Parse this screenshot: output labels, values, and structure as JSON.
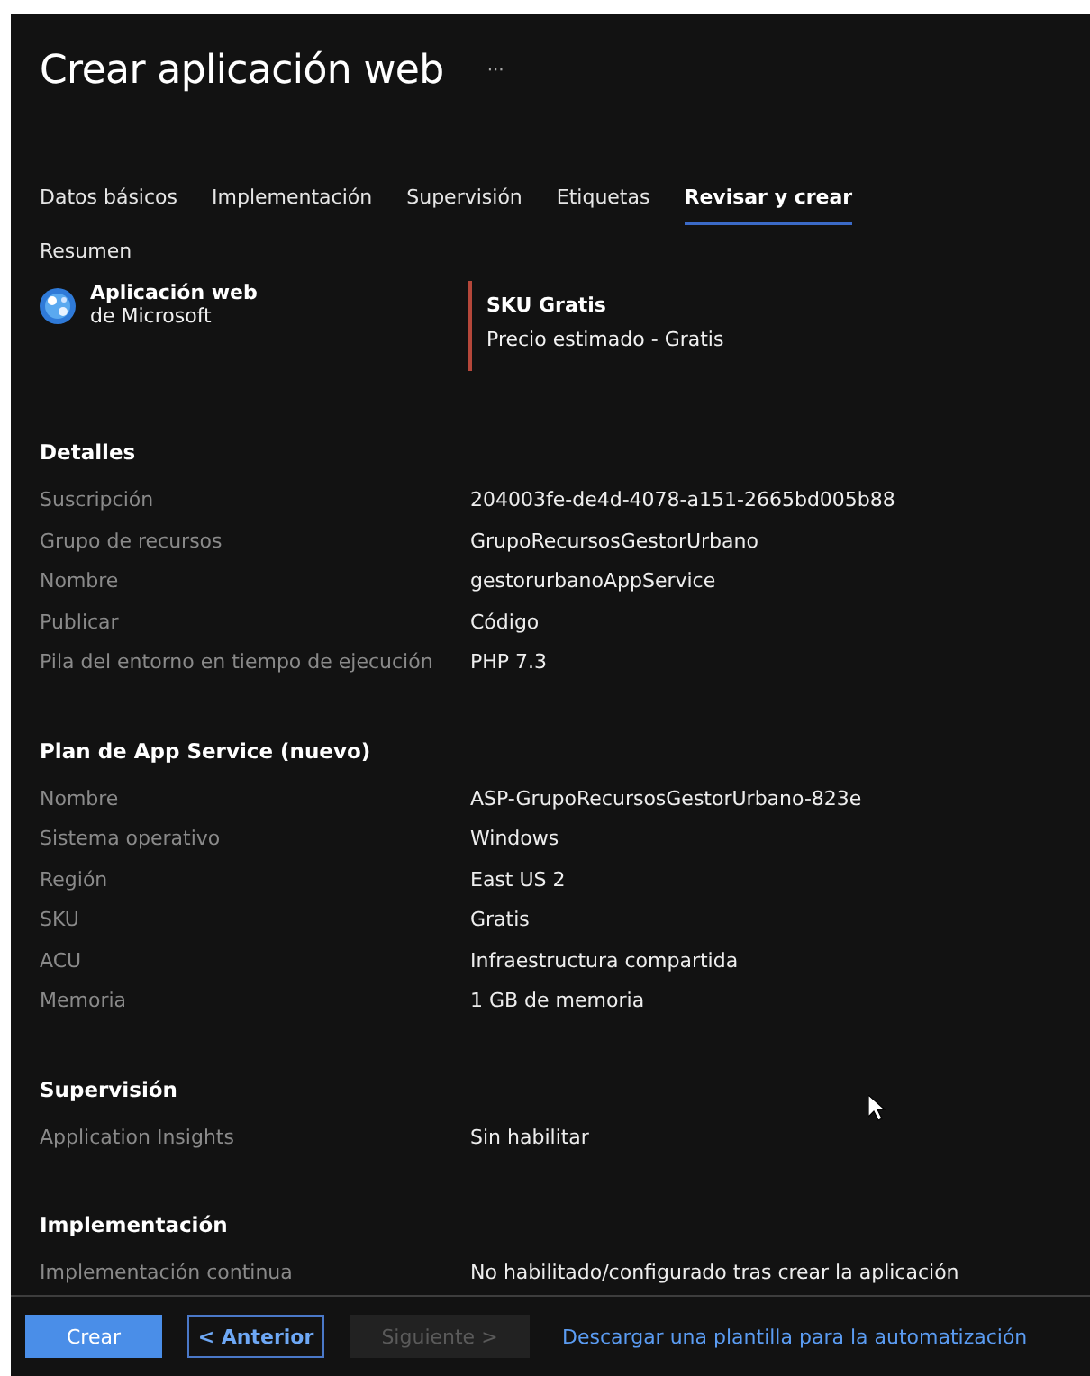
{
  "window": {
    "title": "Crear aplicación web",
    "more": "···"
  },
  "tabs": [
    {
      "label": "Datos básicos",
      "selected": false
    },
    {
      "label": "Implementación",
      "selected": false
    },
    {
      "label": "Supervisión",
      "selected": false
    },
    {
      "label": "Etiquetas",
      "selected": false
    },
    {
      "label": "Revisar y crear",
      "selected": true
    }
  ],
  "summary": {
    "heading": "Resumen",
    "product": {
      "name": "Aplicación web",
      "publisher": "de Microsoft"
    },
    "sku": {
      "title": "SKU Gratis",
      "price": "Precio estimado - Gratis"
    }
  },
  "sections": [
    {
      "title": "Detalles",
      "rows": [
        {
          "label": "Suscripción",
          "value": "204003fe-de4d-4078-a151-2665bd005b88"
        },
        {
          "label": "Grupo de recursos",
          "value": "GrupoRecursosGestorUrbano"
        },
        {
          "label": "Nombre",
          "value": "gestorurbanoAppService"
        },
        {
          "label": "Publicar",
          "value": "Código"
        },
        {
          "label": "Pila del entorno en tiempo de ejecución",
          "value": "PHP 7.3"
        }
      ]
    },
    {
      "title": "Plan de App Service (nuevo)",
      "rows": [
        {
          "label": "Nombre",
          "value": "ASP-GrupoRecursosGestorUrbano-823e"
        },
        {
          "label": "Sistema operativo",
          "value": "Windows"
        },
        {
          "label": "Región",
          "value": "East US 2"
        },
        {
          "label": "SKU",
          "value": "Gratis"
        },
        {
          "label": "ACU",
          "value": "Infraestructura compartida"
        },
        {
          "label": "Memoria",
          "value": "1 GB de memoria"
        }
      ]
    },
    {
      "title": "Supervisión",
      "rows": [
        {
          "label": "Application Insights",
          "value": "Sin habilitar"
        }
      ]
    },
    {
      "title": "Implementación",
      "rows": [
        {
          "label": "Implementación continua",
          "value": "No habilitado/configurado tras crear la aplicación"
        }
      ]
    }
  ],
  "footer": {
    "buttons": [
      {
        "label": "Crear",
        "kind": "primary",
        "disabled": false
      },
      {
        "label": "< Anterior",
        "kind": "secondary",
        "disabled": false
      },
      {
        "label": "Siguiente >",
        "kind": "secondary",
        "disabled": true
      }
    ],
    "link": "Descargar una plantilla para la automatización"
  }
}
